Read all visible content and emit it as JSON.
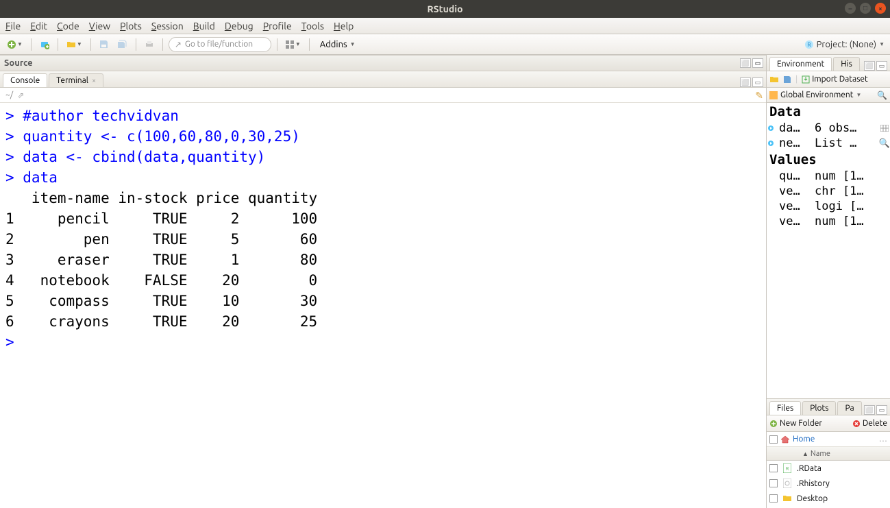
{
  "window": {
    "title": "RStudio"
  },
  "menubar": [
    "File",
    "Edit",
    "Code",
    "View",
    "Plots",
    "Session",
    "Build",
    "Debug",
    "Profile",
    "Tools",
    "Help"
  ],
  "toolbar": {
    "goto_placeholder": "Go to file/function",
    "addins_label": "Addins",
    "project_label": "Project: (None)"
  },
  "panes": {
    "source_title": "Source",
    "console_tabs": {
      "console": "Console",
      "terminal": "Terminal"
    },
    "console_path": "~/"
  },
  "console": {
    "prompt": ">",
    "lines": [
      {
        "p": "> ",
        "t": "#author techvidvan",
        "c": "blue"
      },
      {
        "p": "> ",
        "t": "quantity <- c(100,60,80,0,30,25)",
        "c": "blue"
      },
      {
        "p": "> ",
        "t": "data <- cbind(data,quantity)",
        "c": "blue"
      },
      {
        "p": "> ",
        "t": "data",
        "c": "blue"
      }
    ],
    "table_header": "   item-name in-stock price quantity",
    "table_rows": [
      "1     pencil     TRUE     2      100",
      "2        pen     TRUE     5       60",
      "3     eraser     TRUE     1       80",
      "4   notebook    FALSE    20        0",
      "5    compass     TRUE    10       30",
      "6    crayons     TRUE    20       25"
    ]
  },
  "env": {
    "tabs": {
      "environment": "Environment",
      "history": "His"
    },
    "import_label": "Import Dataset",
    "scope_label": "Global Environment",
    "section_data": "Data",
    "section_values": "Values",
    "data_rows": [
      {
        "name": "da…",
        "val": "6 obs…",
        "icon": "grid"
      },
      {
        "name": "ne…",
        "val": "List …",
        "icon": "search"
      }
    ],
    "value_rows": [
      {
        "name": "qu…",
        "val": "num [1…"
      },
      {
        "name": "ve…",
        "val": "chr [1…"
      },
      {
        "name": "ve…",
        "val": "logi […"
      },
      {
        "name": "ve…",
        "val": "num [1…"
      }
    ]
  },
  "files": {
    "tabs": {
      "files": "Files",
      "plots": "Plots",
      "packages": "Pa"
    },
    "new_folder": "New Folder",
    "delete": "Delete",
    "breadcrumb": "Home",
    "col_name": "Name",
    "rows": [
      {
        "name": ".RData",
        "kind": "rdata"
      },
      {
        "name": ".Rhistory",
        "kind": "rhist"
      },
      {
        "name": "Desktop",
        "kind": "folder"
      }
    ]
  }
}
